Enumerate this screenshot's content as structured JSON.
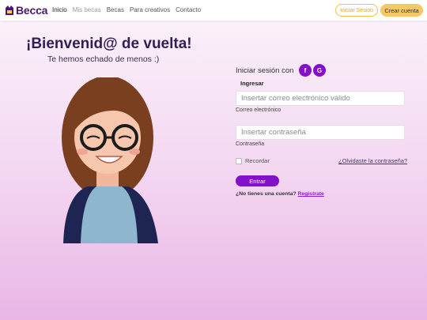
{
  "brand": {
    "name": "Becca",
    "logo_color": "#4a1670"
  },
  "nav": {
    "links": [
      "Inicio",
      "Mis becas",
      "Becas",
      "Para creativos",
      "Contacto"
    ],
    "login_label": "Iniciar Sesión",
    "register_label": "Crear cuenta"
  },
  "hero": {
    "title": "¡Bienvenid@ de vuelta!",
    "subtitle": "Te hemos echado de menos :)"
  },
  "login": {
    "login_with": "Iniciar sesión con",
    "facebook_glyph": "f",
    "google_glyph": "G",
    "section_label": "Ingresar",
    "email_placeholder": "Insertar correo electrónico válido",
    "email_label": "Correo electrónico",
    "password_placeholder": "Insertar contraseña",
    "password_label": "Contraseña",
    "remember_label": "Recordar",
    "forgot_label": "¿Olvidaste la contraseña?",
    "submit_label": "Entrar",
    "no_account_text": "¿No tienes una cuenta?",
    "register_link": "Registrate"
  },
  "colors": {
    "primary": "#8410c9",
    "accent": "#f4c862",
    "title": "#341c55"
  },
  "icons": [
    "becca-logo-icon",
    "facebook-icon",
    "google-icon",
    "avatar-illustration"
  ]
}
